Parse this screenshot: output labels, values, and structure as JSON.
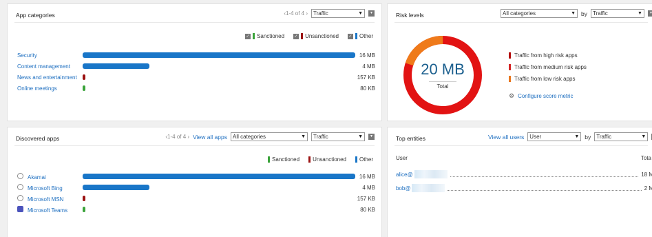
{
  "colors": {
    "sanctioned": "#3aa33a",
    "unsanctioned": "#9b1212",
    "other": "#1976c8",
    "high": "#b40e0e",
    "medium": "#d42424",
    "low": "#e8761e",
    "donut_main": "#e21313",
    "donut_low": "#ef7a1a"
  },
  "app_categories": {
    "title": "App categories",
    "pager": "‹1-4 of 4 ›",
    "metric_select": "Traffic",
    "legend": {
      "sanctioned": "Sanctioned",
      "unsanctioned": "Unsanctioned",
      "other": "Other"
    },
    "rows": [
      {
        "label": "Security",
        "value": "16 MB",
        "fraction": 1.0,
        "kind": "other"
      },
      {
        "label": "Content management",
        "value": "4 MB",
        "fraction": 0.245,
        "kind": "other"
      },
      {
        "label": "News and entertainment",
        "value": "157 KB",
        "fraction": 0.01,
        "kind": "unsanctioned"
      },
      {
        "label": "Online meetings",
        "value": "80 KB",
        "fraction": 0.006,
        "kind": "sanctioned"
      }
    ]
  },
  "risk_levels": {
    "title": "Risk levels",
    "category_select": "All categories",
    "by_label": "by",
    "metric_select": "Traffic",
    "donut_value": "20 MB",
    "donut_caption": "Total",
    "low_fraction": 0.2,
    "legend": [
      {
        "label": "Traffic from high risk apps",
        "kind": "high"
      },
      {
        "label": "Traffic from medium risk apps",
        "kind": "medium"
      },
      {
        "label": "Traffic from low risk apps",
        "kind": "low"
      }
    ],
    "configure_link": "Configure score metric"
  },
  "discovered_apps": {
    "title": "Discovered apps",
    "pager": "‹1-4 of 4 ›",
    "view_all": "View all apps",
    "category_select": "All categories",
    "metric_select": "Traffic",
    "legend": {
      "sanctioned": "Sanctioned",
      "unsanctioned": "Unsanctioned",
      "other": "Other"
    },
    "rows": [
      {
        "label": "Akamai",
        "value": "16 MB",
        "fraction": 1.0,
        "kind": "other",
        "icon": "globe-icon"
      },
      {
        "label": "Microsoft Bing",
        "value": "4 MB",
        "fraction": 0.245,
        "kind": "other",
        "icon": "globe-icon"
      },
      {
        "label": "Microsoft MSN",
        "value": "157 KB",
        "fraction": 0.01,
        "kind": "unsanctioned",
        "icon": "globe-icon"
      },
      {
        "label": "Microsoft Teams",
        "value": "80 KB",
        "fraction": 0.006,
        "kind": "sanctioned",
        "icon": "teams-icon"
      }
    ]
  },
  "top_entities": {
    "title": "Top entities",
    "view_all": "View all users",
    "entity_select": "User",
    "by_label": "by",
    "metric_select": "Traffic",
    "col_user": "User",
    "col_total": "Tota",
    "rows": [
      {
        "name": "alice@",
        "value": "18 M"
      },
      {
        "name": "bob@",
        "value": "2 M"
      }
    ]
  }
}
